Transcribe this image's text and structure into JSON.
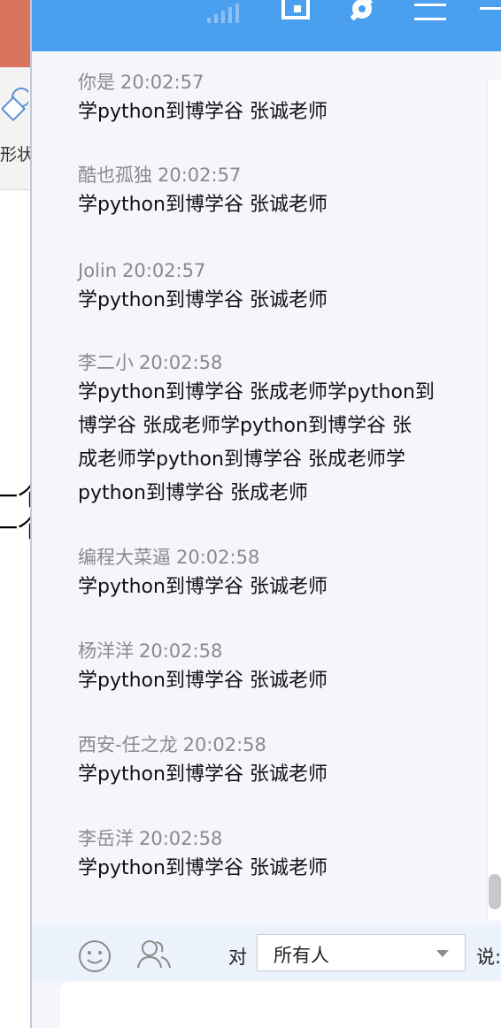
{
  "background_app": {
    "toolbar_label": "形状",
    "doc_text_lines": [
      "一个",
      "一个"
    ]
  },
  "titlebar": {
    "icons": [
      "signal-icon",
      "phone-icon",
      "gear-icon",
      "menu-icon",
      "minimize-icon"
    ]
  },
  "messages": [
    {
      "user": "你是",
      "time": "20:02:57",
      "text": "学python到博学谷 张诚老师"
    },
    {
      "user": "酷也孤独",
      "time": "20:02:57",
      "text": "学python到博学谷  张诚老师"
    },
    {
      "user": "Jolin",
      "time": "20:02:57",
      "text": "学python到博学谷 张诚老师"
    },
    {
      "user": "李二小",
      "time": "20:02:58",
      "text_lines": [
        "学python到博学谷  张成老师学python到",
        "博学谷  张成老师学python到博学谷  张",
        "成老师学python到博学谷  张成老师学",
        "python到博学谷  张成老师"
      ]
    },
    {
      "user": "编程大菜逼",
      "time": "20:02:58",
      "text": "学python到博学谷 张诚老师"
    },
    {
      "user": "杨洋洋",
      "time": "20:02:58",
      "text": "学python到博学谷 张诚老师"
    },
    {
      "user": "西安-任之龙",
      "time": "20:02:58",
      "text": "学python到博学谷  张诚老师"
    },
    {
      "user": "李岳洋",
      "time": "20:02:58",
      "text": "学python到博学谷 张诚老师"
    }
  ],
  "input_bar": {
    "to_label": "对",
    "recipient": "所有人",
    "say_label": "说:"
  },
  "colors": {
    "titlebar": "#4aa0ee",
    "chat_bg": "#f4f6fc",
    "meta_text": "#8a8a8a"
  }
}
